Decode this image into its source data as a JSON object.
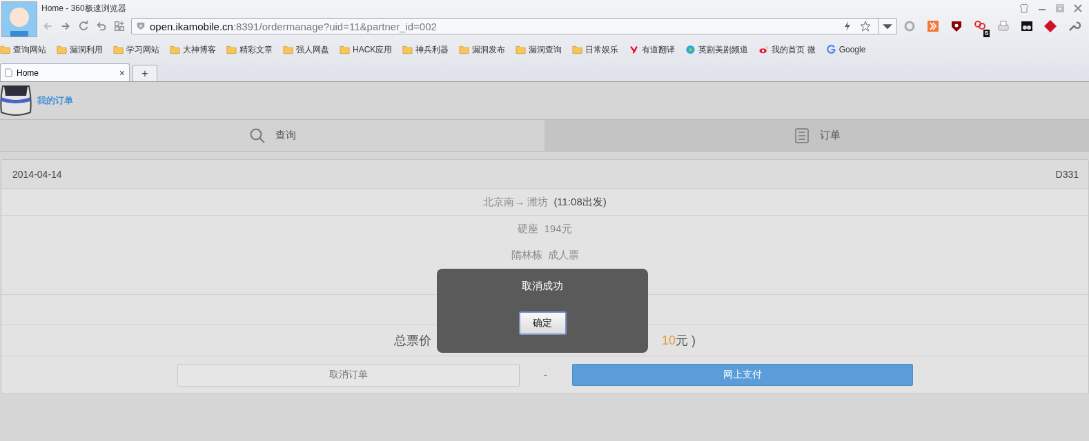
{
  "window": {
    "title": "Home - 360极速浏览器"
  },
  "address_bar": {
    "host": "open.ikamobile.cn",
    "rest": ":8391/ordermanage?uid=11&partner_id=002"
  },
  "bookmarks": [
    {
      "label": "查询网站",
      "kind": "folder"
    },
    {
      "label": "漏洞利用",
      "kind": "folder"
    },
    {
      "label": "学习网站",
      "kind": "folder"
    },
    {
      "label": "大神博客",
      "kind": "folder"
    },
    {
      "label": "精彩文章",
      "kind": "folder"
    },
    {
      "label": "强人网盘",
      "kind": "folder"
    },
    {
      "label": "HACK应用",
      "kind": "folder"
    },
    {
      "label": "神兵利器",
      "kind": "folder"
    },
    {
      "label": "漏洞发布",
      "kind": "folder"
    },
    {
      "label": "漏洞查询",
      "kind": "folder"
    },
    {
      "label": "日常娱乐",
      "kind": "folder"
    },
    {
      "label": "有道翻译",
      "kind": "youdao"
    },
    {
      "label": "英剧美剧频道",
      "kind": "play"
    },
    {
      "label": "我的首页 微",
      "kind": "weibo"
    },
    {
      "label": "Google",
      "kind": "google"
    }
  ],
  "extension_badge": "5",
  "browser_tabs": [
    {
      "label": "Home",
      "close": "×",
      "selected": true
    }
  ],
  "new_tab": "+",
  "page_header": {
    "title": "我的订单"
  },
  "nav_tabs": [
    {
      "label": "查询",
      "selected": false
    },
    {
      "label": "订单",
      "selected": true
    }
  ],
  "order": {
    "date": "2014-04-14",
    "train": "D331",
    "route": "北京南→ 潍坊",
    "departure": "(11:08出发)",
    "seat": "硬座",
    "seat_price": "194元",
    "passenger": "隋林栋",
    "ticket_type": "成人票",
    "price_label": "总票价",
    "price_tail": [
      {
        "text": "10",
        "highlight": true
      },
      {
        "text": "元 )",
        "highlight": false
      }
    ],
    "cancel_button": "取消订单",
    "separator": "-",
    "pay_button": "网上支付"
  },
  "dialog": {
    "message": "取消成功",
    "ok_button": "确定"
  }
}
